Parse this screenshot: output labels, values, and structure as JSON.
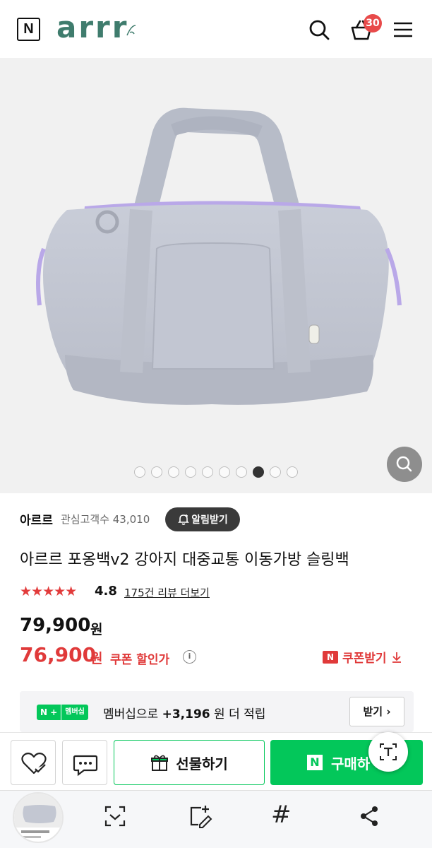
{
  "header": {
    "n_logo": "N",
    "brand": "arrr",
    "cart_count": "30",
    "icons": [
      "search-icon",
      "cart-icon",
      "menu-icon"
    ]
  },
  "gallery": {
    "slide_count": 10,
    "active_index": 7
  },
  "store": {
    "name": "아르르",
    "fans_label": "관심고객수 43,010",
    "alarm_label": "알림받기"
  },
  "product": {
    "title": "아르르 포옹백v2 강아지 대중교통 이동가방 슬링백",
    "stars": "★★★★★",
    "rating": "4.8",
    "reviews_link": "175건 리뷰 더보기",
    "price_original": "79,900",
    "price_original_unit": "원",
    "price_sale": "76,900",
    "price_sale_unit": "원",
    "coupon_label": "쿠폰 할인가",
    "info_icon": "i",
    "coupon_get_badge": "N",
    "coupon_get_label": "쿠폰받기"
  },
  "membership": {
    "badge_n": "N +",
    "badge_text": "멤버십",
    "text_prefix": "멤버십으로 ",
    "points": "+3,196",
    "text_suffix": " 원 더 적립",
    "receive_label": "받기"
  },
  "buy_bar": {
    "gift_label": "선물하기",
    "buy_badge": "N",
    "buy_label": "구매하"
  },
  "colors": {
    "naver_green": "#03c75a",
    "sale_red": "#e03a3a",
    "brand_teal": "#3f7c6d"
  }
}
